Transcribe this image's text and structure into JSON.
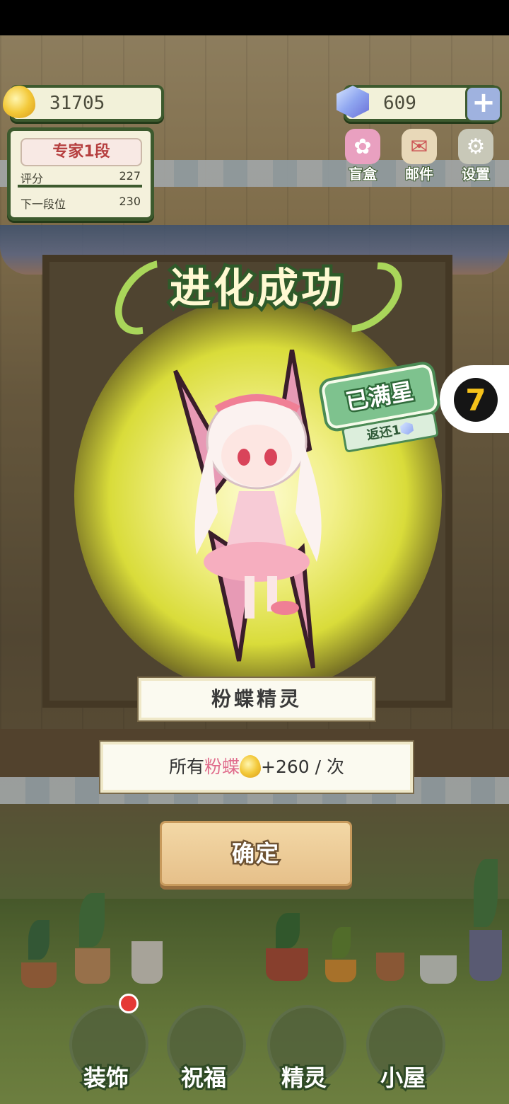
{
  "top_bar": {
    "coins": "31705",
    "gems": "609",
    "plus_icon": "plus-icon",
    "coin_icon": "golden-drop-icon",
    "gem_icon": "blue-gem-icon"
  },
  "rank_panel": {
    "title": "专家1段",
    "score_label": "评分",
    "score_value": "227",
    "next_label": "下一段位",
    "next_value": "230"
  },
  "top_buttons": [
    {
      "label": "盲盒",
      "icon": "blind-box-icon",
      "color": "#e9a0c0"
    },
    {
      "label": "邮件",
      "icon": "mail-icon",
      "color": "#e8d8b8"
    },
    {
      "label": "设置",
      "icon": "gear-icon",
      "color": "#c8c8b8"
    }
  ],
  "dialog": {
    "title": "进化成功",
    "badge_title": "已满星",
    "badge_sub": "返还1",
    "fairy_name": "粉蝶精灵",
    "bonus_prefix": "所有",
    "bonus_highlight": "粉蝶",
    "bonus_suffix": "+260 / 次",
    "confirm_label": "确定"
  },
  "side_tab": {
    "icon": "seven-cat-icon",
    "glyph": "7"
  },
  "bottom_nav": [
    {
      "label": "装饰",
      "icon": "decor-plant-icon"
    },
    {
      "label": "祝福",
      "icon": "blessing-butterfly-icon"
    },
    {
      "label": "精灵",
      "icon": "fairy-avatar-icon"
    },
    {
      "label": "小屋",
      "icon": "house-icon"
    }
  ],
  "colors": {
    "accent_green": "#3d5a2e",
    "glow_yellow": "#e8e84a",
    "pink": "#e06c8c"
  }
}
